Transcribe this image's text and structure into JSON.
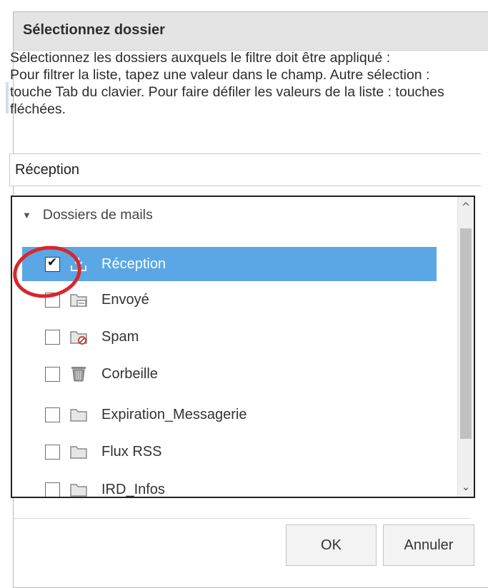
{
  "dialog": {
    "title": "Sélectionnez dossier",
    "instructions": [
      "Sélectionnez les dossiers auxquels le filtre doit être appliqué :",
      "Pour filtrer la liste, tapez une valeur dans le champ. Autre sélection : touche Tab du clavier. Pour faire défiler les valeurs de la liste : touches fléchées."
    ],
    "filter_value": "Réception"
  },
  "tree": {
    "root_label": "Dossiers de mails",
    "items": [
      {
        "label": "Réception",
        "icon": "inbox-icon",
        "checked": true,
        "selected": true
      },
      {
        "label": "Envoyé",
        "icon": "sent-folder-icon",
        "checked": false
      },
      {
        "label": "Spam",
        "icon": "spam-folder-icon",
        "checked": false
      },
      {
        "label": "Corbeille",
        "icon": "trash-icon",
        "checked": false
      },
      {
        "label": "Expiration_Messagerie",
        "icon": "folder-icon",
        "checked": false
      },
      {
        "label": "Flux RSS",
        "icon": "folder-icon",
        "checked": false
      },
      {
        "label": "IRD_Infos",
        "icon": "folder-icon",
        "checked": false
      }
    ]
  },
  "buttons": {
    "ok": "OK",
    "cancel": "Annuler"
  },
  "colors": {
    "selection": "#5ba7e6",
    "annotation_circle": "#d8262c"
  }
}
